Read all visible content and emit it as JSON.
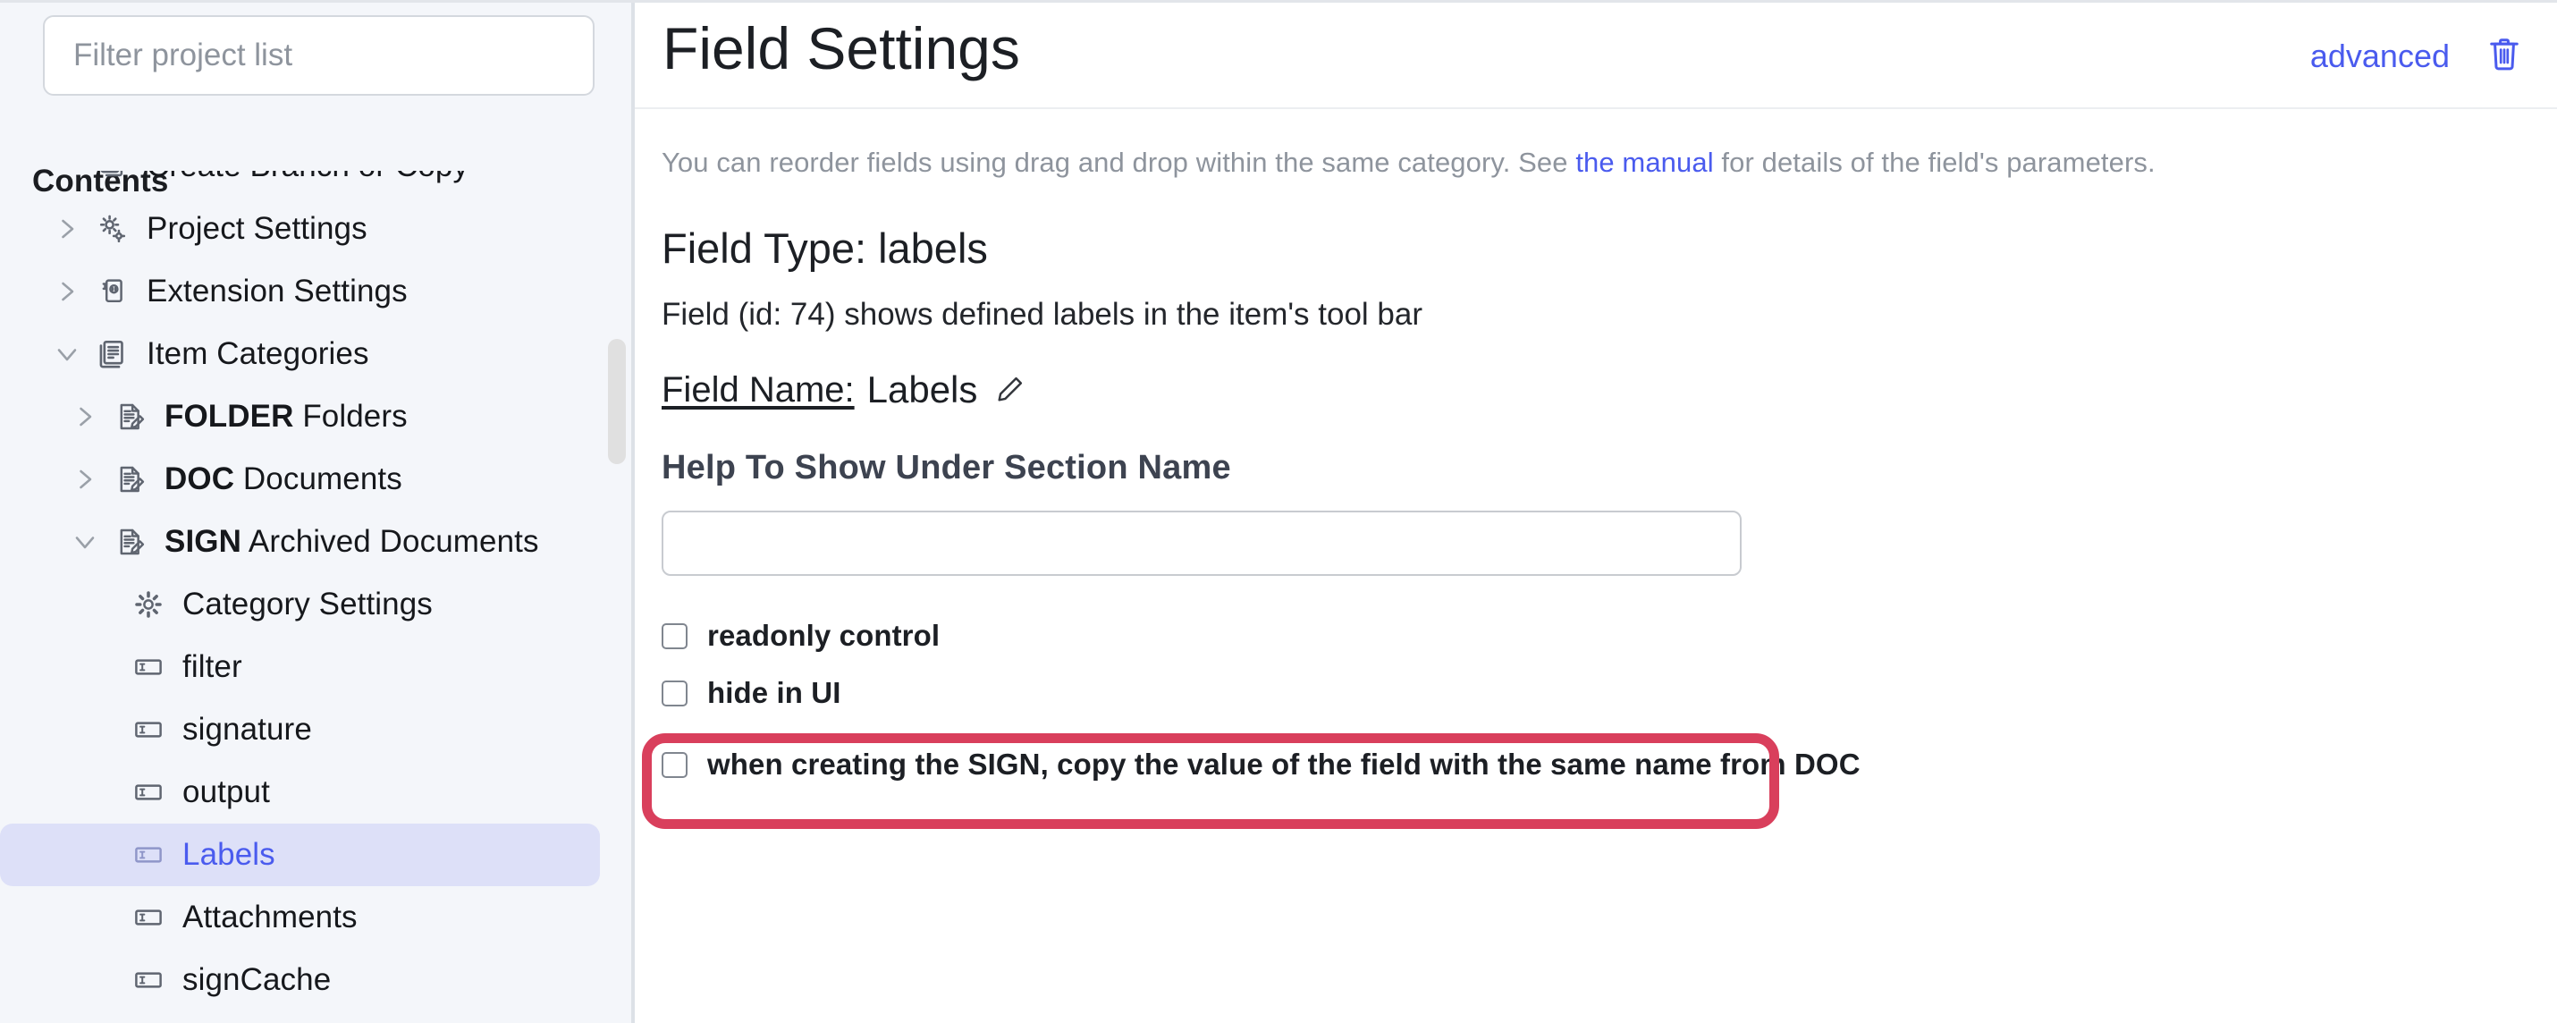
{
  "sidebar": {
    "filter": {
      "placeholder": "Filter project list",
      "value": ""
    },
    "contents_heading": "Contents",
    "tree": [
      {
        "label": "Create Branch or Copy",
        "code": "",
        "level": 0,
        "twisty": "none",
        "icon": "copy-icon",
        "selected": false,
        "clipped": true
      },
      {
        "label": "Project Settings",
        "code": "",
        "level": 0,
        "twisty": "collapsed",
        "icon": "gears-icon",
        "selected": false
      },
      {
        "label": "Extension Settings",
        "code": "",
        "level": 0,
        "twisty": "collapsed",
        "icon": "plug-icon",
        "selected": false
      },
      {
        "label": "Item Categories",
        "code": "",
        "level": 0,
        "twisty": "expanded",
        "icon": "documents-icon",
        "selected": false
      },
      {
        "label": "Folders",
        "code": "FOLDER",
        "level": 1,
        "twisty": "collapsed",
        "icon": "document-edit-icon",
        "selected": false
      },
      {
        "label": "Documents",
        "code": "DOC",
        "level": 1,
        "twisty": "collapsed",
        "icon": "document-edit-icon",
        "selected": false
      },
      {
        "label": "Archived Documents",
        "code": "SIGN",
        "level": 1,
        "twisty": "expanded",
        "icon": "document-edit-icon",
        "selected": false
      },
      {
        "label": "Category Settings",
        "code": "",
        "level": 2,
        "twisty": "none",
        "icon": "gear-icon",
        "selected": false
      },
      {
        "label": "filter",
        "code": "",
        "level": 2,
        "twisty": "none",
        "icon": "text-field-icon",
        "selected": false
      },
      {
        "label": "signature",
        "code": "",
        "level": 2,
        "twisty": "none",
        "icon": "text-field-icon",
        "selected": false
      },
      {
        "label": "output",
        "code": "",
        "level": 2,
        "twisty": "none",
        "icon": "text-field-icon",
        "selected": false
      },
      {
        "label": "Labels",
        "code": "",
        "level": 2,
        "twisty": "none",
        "icon": "text-field-icon",
        "selected": true
      },
      {
        "label": "Attachments",
        "code": "",
        "level": 2,
        "twisty": "none",
        "icon": "text-field-icon",
        "selected": false
      },
      {
        "label": "signCache",
        "code": "",
        "level": 2,
        "twisty": "none",
        "icon": "text-field-icon",
        "selected": false
      }
    ]
  },
  "header": {
    "title": "Field Settings",
    "advanced_label": "advanced",
    "delete_icon": "trash-icon"
  },
  "main": {
    "intro_prefix": "You can reorder fields using drag and drop within the same category. See ",
    "intro_link": "the manual",
    "intro_suffix": " for details of the field's parameters.",
    "section_title": "Field Type: labels",
    "field_description": "Field (id: 74) shows defined labels in the item's tool bar",
    "field_name_label": "Field Name:",
    "field_name_value": "Labels",
    "edit_icon": "pencil-icon",
    "help_label": "Help To Show Under Section Name",
    "help_input_value": "",
    "help_input_placeholder": "",
    "checkboxes": [
      {
        "label": "readonly control",
        "checked": false,
        "highlighted": false
      },
      {
        "label": "hide in UI",
        "checked": false,
        "highlighted": false
      },
      {
        "label": "when creating the SIGN, copy the value of the field with the same name from DOC",
        "checked": false,
        "highlighted": true
      }
    ]
  },
  "colors": {
    "accent": "#4a5bee",
    "highlight_border": "#d93f5c",
    "selected_row_bg": "#dde0f8",
    "sidebar_bg": "#f4f6fa",
    "muted_text": "#8e949d"
  }
}
